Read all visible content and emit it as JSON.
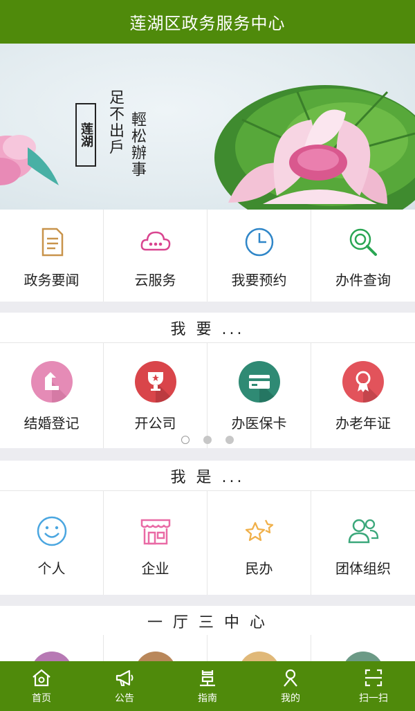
{
  "header": {
    "title": "莲湖区政务服务中心"
  },
  "banner": {
    "seal_text": "莲湖",
    "slogan_line1": "足不出戶",
    "slogan_line2": "輕松辦事"
  },
  "quick_services": [
    {
      "label": "政务要闻",
      "icon": "document-icon",
      "color": "#c8934a"
    },
    {
      "label": "云服务",
      "icon": "cloud-icon",
      "color": "#d9448f"
    },
    {
      "label": "我要预约",
      "icon": "clock-icon",
      "color": "#2f86c8"
    },
    {
      "label": "办件查询",
      "icon": "search-icon",
      "color": "#2aa653"
    }
  ],
  "want": {
    "title": "我 要 ...",
    "items": [
      {
        "label": "结婚登记",
        "icon": "marriage-icon",
        "color": "#e58bb6"
      },
      {
        "label": "开公司",
        "icon": "trophy-icon",
        "color": "#d9454a"
      },
      {
        "label": "办医保卡",
        "icon": "card-icon",
        "color": "#2f8a74"
      },
      {
        "label": "办老年证",
        "icon": "award-icon",
        "color": "#e2535b"
      }
    ],
    "pager_total": 3,
    "pager_current": 1
  },
  "iam": {
    "title": "我 是 ...",
    "items": [
      {
        "label": "个人",
        "icon": "smiley-icon",
        "color": "#4aa6e0"
      },
      {
        "label": "企业",
        "icon": "shop-icon",
        "color": "#e96aa5"
      },
      {
        "label": "民办",
        "icon": "stars-icon",
        "color": "#f0b04a"
      },
      {
        "label": "团体组织",
        "icon": "group-icon",
        "color": "#3aa77a"
      }
    ]
  },
  "hall": {
    "title": "一 厅 三 中 心"
  },
  "tabbar": [
    {
      "label": "首页",
      "icon": "home-icon"
    },
    {
      "label": "公告",
      "icon": "megaphone-icon"
    },
    {
      "label": "指南",
      "icon": "guide-icon"
    },
    {
      "label": "我的",
      "icon": "profile-icon"
    },
    {
      "label": "扫一扫",
      "icon": "scan-icon"
    }
  ],
  "colors": {
    "brand_green": "#4f8a0b"
  }
}
